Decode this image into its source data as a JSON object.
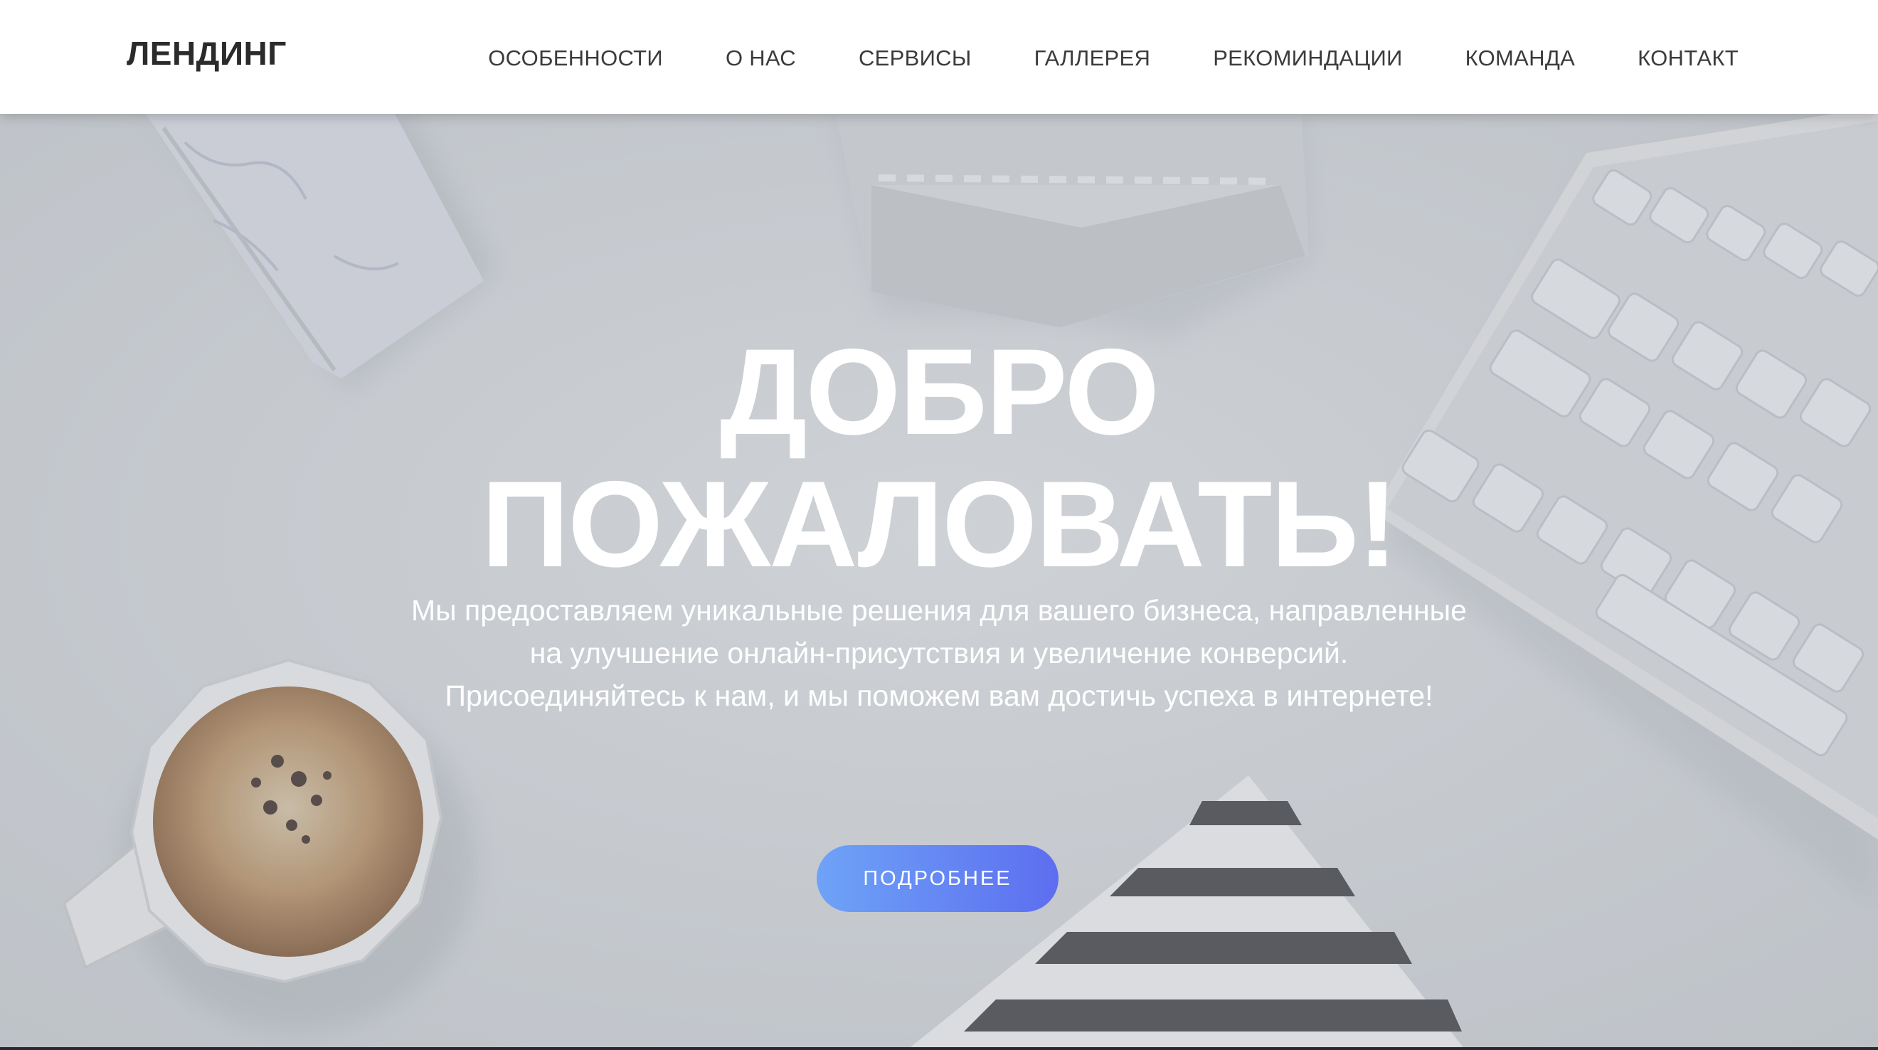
{
  "header": {
    "logo": "ЛЕНДИНГ",
    "nav": [
      {
        "label": "ОСОБЕННОСТИ"
      },
      {
        "label": "О НАС"
      },
      {
        "label": "СЕРВИСЫ"
      },
      {
        "label": "ГАЛЛЕРЕЯ"
      },
      {
        "label": "РЕКОМИНДАЦИИ"
      },
      {
        "label": "КОМАНДА"
      },
      {
        "label": "КОНТАКТ"
      }
    ]
  },
  "hero": {
    "title_line1": "ДОБРО",
    "title_line2": "ПОЖАЛОВАТЬ!",
    "text": "Мы предоставляем уникальные решения для вашего бизнеса, направленные на улучшение онлайн-присутствия и увеличение конверсий. Присоединяйтесь к нам, и мы поможем вам достичь успеха в интернете!",
    "button_label": "ПОДРОБНЕЕ"
  },
  "colors": {
    "button_gradient_start": "#6ea3f7",
    "button_gradient_end": "#5d6ef0",
    "header_bg": "#ffffff",
    "logo_text": "#2b2b2b"
  },
  "icons": {
    "background_photo": "desk-flatlay-photo"
  }
}
